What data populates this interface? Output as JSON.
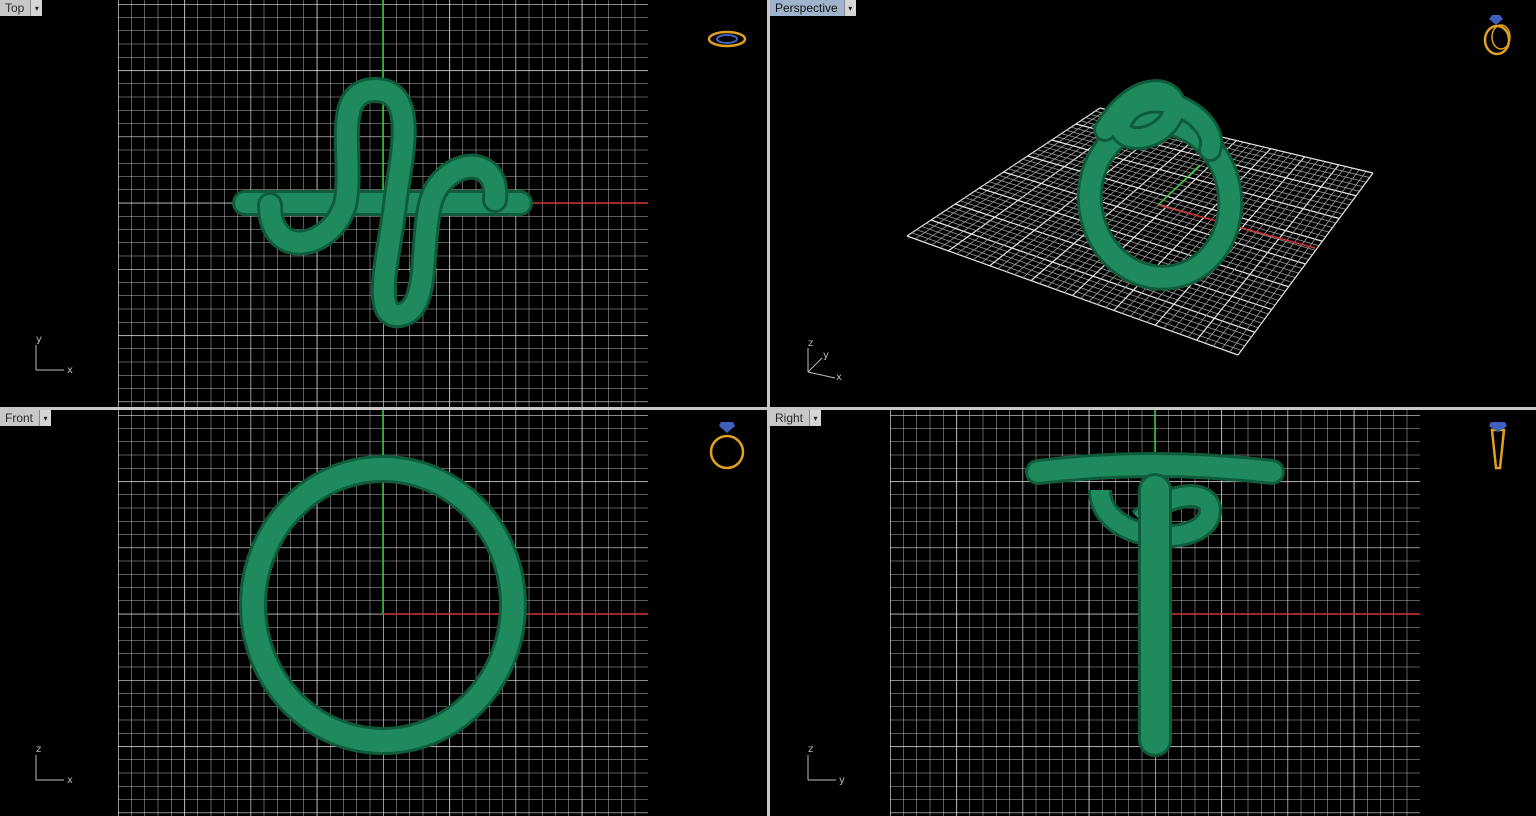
{
  "viewports": [
    {
      "id": "top",
      "label": "Top",
      "active": false,
      "axis_v": "y",
      "axis_h": "x"
    },
    {
      "id": "perspective",
      "label": "Perspective",
      "active": true,
      "axis_v": "z",
      "axis_h": "x",
      "axis_d": "y"
    },
    {
      "id": "front",
      "label": "Front",
      "active": false,
      "axis_v": "z",
      "axis_h": "x"
    },
    {
      "id": "right",
      "label": "Right",
      "active": false,
      "axis_v": "z",
      "axis_h": "y"
    }
  ],
  "dropdown_glyph": "▾",
  "colors": {
    "model": "#1f8a5e",
    "model_dark": "#0f5c3c",
    "grid": "#c8c8c8",
    "x_axis": "#c33",
    "y_axis": "#3c3",
    "icon_gold": "#e0a020",
    "icon_gem": "#4060c0"
  },
  "icons": {
    "preview": "ring-preview-icon"
  }
}
